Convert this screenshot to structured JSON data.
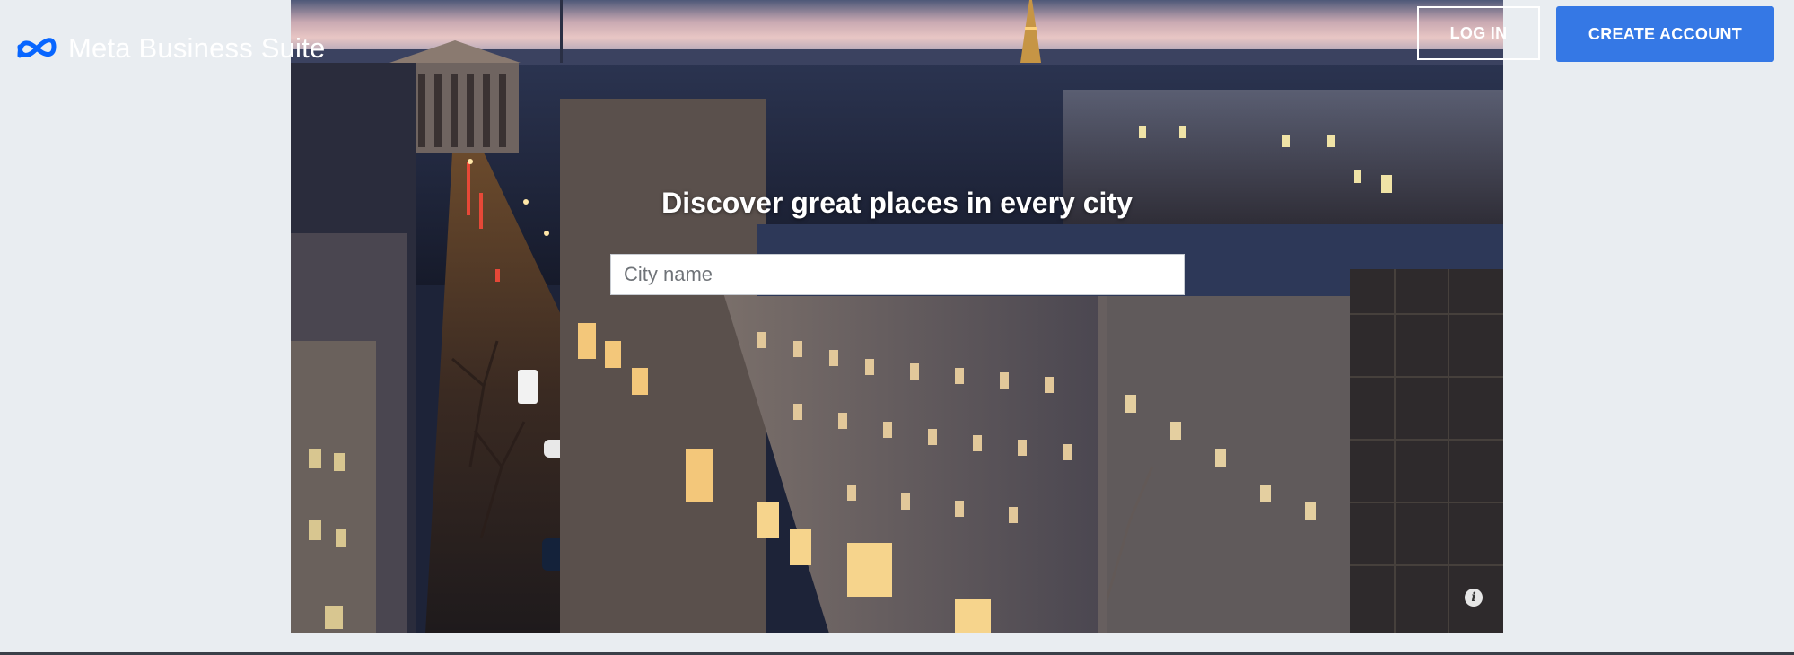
{
  "brand": {
    "name": "Meta Business Suite",
    "logo_icon": "meta-infinity-icon"
  },
  "header": {
    "login_label": "LOG IN",
    "create_account_label": "CREATE ACCOUNT"
  },
  "hero": {
    "title": "Discover great places in every city",
    "search_placeholder": "City name",
    "info_icon": "info-icon",
    "image": "night-city-street-photo"
  },
  "colors": {
    "page_background": "#e9edf1",
    "create_account_button": "#3578e5",
    "brand_logo": "#0866ff"
  }
}
